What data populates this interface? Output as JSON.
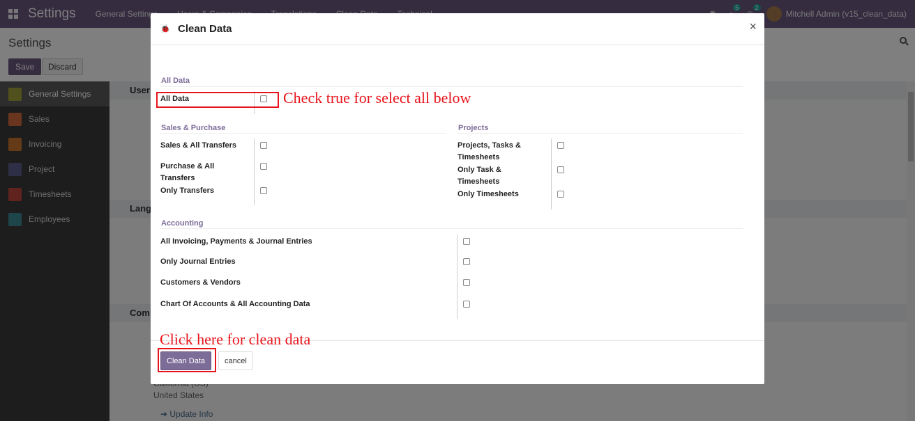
{
  "navbar": {
    "brand": "Settings",
    "menu": [
      "General Settings",
      "Users & Companies",
      "Translations",
      "Clean Data",
      "Technical"
    ],
    "chat_count": "5",
    "activity_count": "2",
    "user": "Mitchell Admin (v15_clean_data)"
  },
  "control_panel": {
    "title": "Settings",
    "save_label": "Save",
    "discard_label": "Discard"
  },
  "sidebar": {
    "items": [
      {
        "label": "General Settings",
        "color": "#a0a33a"
      },
      {
        "label": "Sales",
        "color": "#d46a3e"
      },
      {
        "label": "Invoicing",
        "color": "#c9772c"
      },
      {
        "label": "Project",
        "color": "#5d5f8d"
      },
      {
        "label": "Timesheets",
        "color": "#c1473c"
      },
      {
        "label": "Employees",
        "color": "#3d8b94"
      }
    ]
  },
  "background": {
    "section_users": "User",
    "section_languages": "Lang",
    "section_companies": "Com",
    "address_state": "California (US)",
    "address_country": "United States",
    "update_info": "➔ Update Info"
  },
  "modal": {
    "title": "Clean Data",
    "close": "×",
    "all_data_group": "All Data",
    "all_data_label": "All Data",
    "sales_group": "Sales & Purchase",
    "sales_items": [
      "Sales & All Transfers",
      "Purchase & All Transfers",
      "Only Transfers"
    ],
    "projects_group": "Projects",
    "project_items": [
      "Projects, Tasks & Timesheets",
      "Only Task & Timesheets",
      "Only Timesheets"
    ],
    "accounting_group": "Accounting",
    "accounting_items": [
      "All Invoicing, Payments & Journal Entries",
      "Only Journal Entries",
      "Customers & Vendors",
      "Chart Of Accounts & All Accounting Data"
    ],
    "clean_button": "Clean Data",
    "cancel_button": "cancel"
  },
  "annotations": {
    "select_all_note": "Check true for select all below",
    "clean_note": "Click here for clean data"
  }
}
